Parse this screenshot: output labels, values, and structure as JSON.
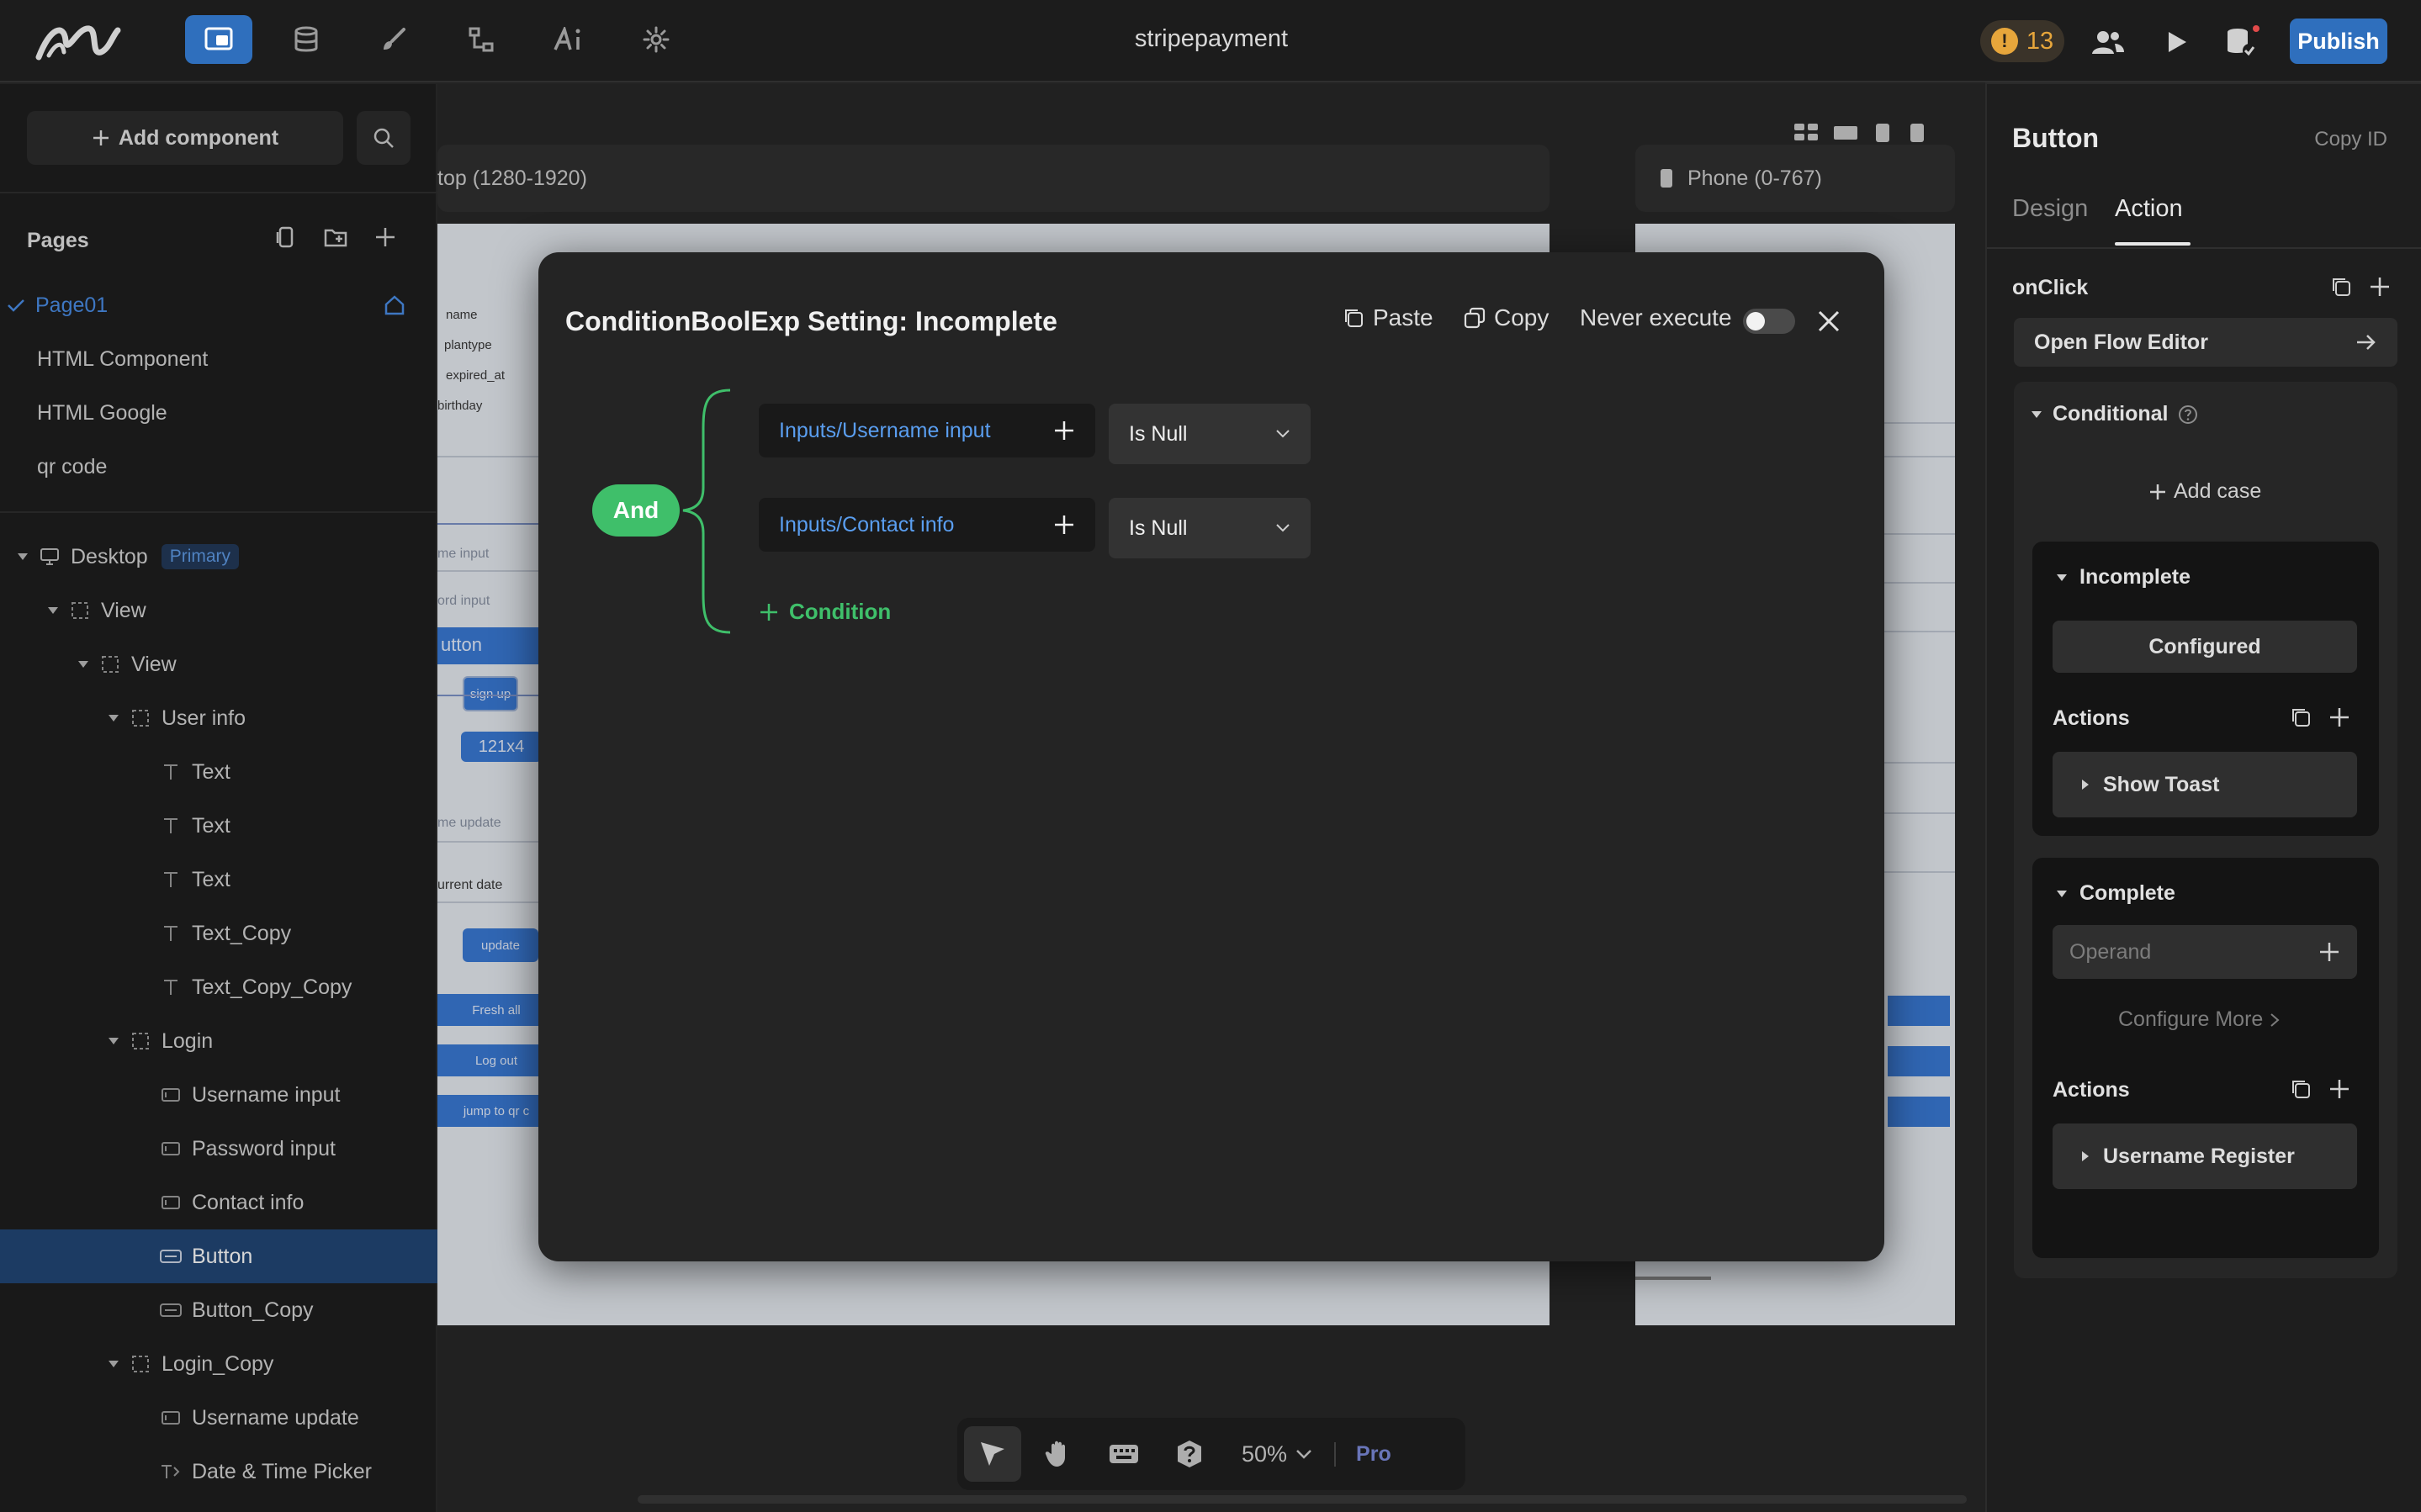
{
  "app": {
    "title": "stripepayment",
    "warning_count": "13",
    "warning_symbol": "!",
    "publish_label": "Publish"
  },
  "left": {
    "add_component_label": "Add component",
    "pages_heading": "Pages",
    "pages": [
      {
        "label": "Page01"
      },
      {
        "label": "HTML Component"
      },
      {
        "label": "HTML Google"
      },
      {
        "label": "qr code"
      }
    ],
    "tree": {
      "desktop_label": "Desktop",
      "desktop_badge": "Primary",
      "items": [
        {
          "label": "View"
        },
        {
          "label": "View"
        },
        {
          "label": "User info"
        },
        {
          "label": "Text"
        },
        {
          "label": "Text"
        },
        {
          "label": "Text"
        },
        {
          "label": "Text_Copy"
        },
        {
          "label": "Text_Copy_Copy"
        },
        {
          "label": "Login"
        },
        {
          "label": "Username input"
        },
        {
          "label": "Password input"
        },
        {
          "label": "Contact info"
        },
        {
          "label": "Button"
        },
        {
          "label": "Button_Copy"
        },
        {
          "label": "Login_Copy"
        },
        {
          "label": "Username update"
        },
        {
          "label": "Date & Time Picker"
        }
      ]
    }
  },
  "canvas": {
    "desktop_tab": "top (1280-1920)",
    "phone_tab": "Phone (0-767)",
    "preview": {
      "fields_top": [
        "name",
        "plantype",
        "expired_at",
        "birthday"
      ],
      "input1": "me input",
      "input2": "ord input",
      "button_text": "utton",
      "signup": "sign up",
      "size_label": "121x4",
      "update_input": "me update",
      "date_input": "urrent date",
      "update_btn": "update",
      "fresh_btn": "Fresh all",
      "logout_btn": "Log out",
      "jump_btn": "jump to qr c"
    },
    "zoom": "50%",
    "pro_label": "Pro"
  },
  "right": {
    "title": "Button",
    "copy_id": "Copy ID",
    "tabs": [
      {
        "label": "Design"
      },
      {
        "label": "Action"
      }
    ],
    "onclick_label": "onClick",
    "open_flow": "Open Flow Editor",
    "conditional_label": "Conditional",
    "add_case": "Add case",
    "incomplete_label": "Incomplete",
    "configured_label": "Configured",
    "actions_label": "Actions",
    "show_toast": "Show Toast",
    "complete_label": "Complete",
    "operand_placeholder": "Operand",
    "configure_more": "Configure More",
    "username_register": "Username Register"
  },
  "modal": {
    "title": "ConditionBoolExp Setting: Incomplete",
    "paste_label": "Paste",
    "copy_label": "Copy",
    "never_execute_label": "Never execute",
    "never_execute_on": false,
    "and_label": "And",
    "conditions": [
      {
        "field": "Inputs/Username input",
        "operator": "Is Null"
      },
      {
        "field": "Inputs/Contact info",
        "operator": "Is Null"
      }
    ],
    "add_condition_label": "Condition"
  },
  "colors": {
    "accent_blue": "#2f6fbd",
    "link_blue": "#5a9ef0",
    "green": "#3fbf6a",
    "warning": "#e7a63b",
    "selection": "#224777"
  }
}
